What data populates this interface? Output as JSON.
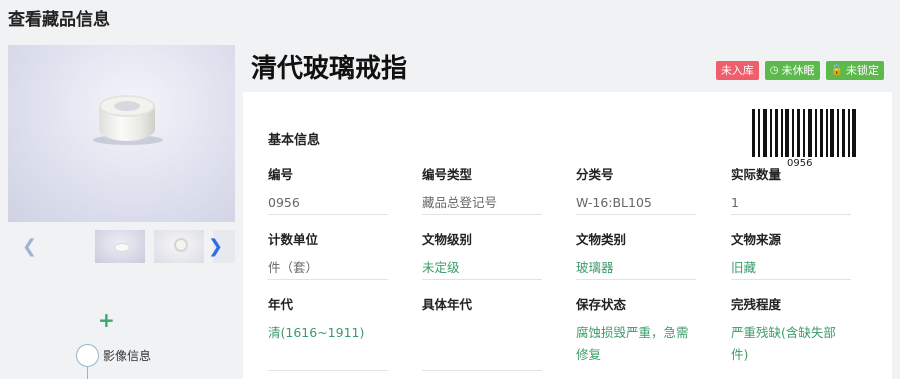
{
  "page": {
    "title": "查看藏品信息"
  },
  "item": {
    "name": "清代玻璃戒指",
    "badges": [
      {
        "label": "未入库",
        "color": "#ef5e6b",
        "icon": ""
      },
      {
        "label": "未休眠",
        "color": "#5cba4c",
        "icon": "clock-icon"
      },
      {
        "label": "未锁定",
        "color": "#5cba4c",
        "icon": "lock-icon"
      }
    ]
  },
  "gallery": {
    "prev_icon": "chevron-left-icon",
    "next_icon": "chevron-right-icon"
  },
  "sidebar": {
    "add_icon": "plus-icon",
    "timeline_label": "影像信息"
  },
  "basic": {
    "section_title": "基本信息",
    "barcode_text": "0956",
    "fields": [
      {
        "label": "编号",
        "value": "0956"
      },
      {
        "label": "编号类型",
        "value": "藏品总登记号"
      },
      {
        "label": "分类号",
        "value": "W-16:BL105"
      },
      {
        "label": "实际数量",
        "value": "1"
      },
      {
        "label": "计数单位",
        "value": "件（套）"
      },
      {
        "label": "文物级别",
        "value": "未定级"
      },
      {
        "label": "文物类别",
        "value": "玻璃器"
      },
      {
        "label": "文物来源",
        "value": "旧藏"
      },
      {
        "label": "年代",
        "value": "清(1616~1911)"
      },
      {
        "label": "具体年代",
        "value": ""
      },
      {
        "label": "保存状态",
        "value": "腐蚀损毁严重，急需修复"
      },
      {
        "label": "完残程度",
        "value": "严重残缺(含缺失部件)"
      }
    ]
  },
  "colors": {
    "accent_green": "#3c9b6a",
    "badge_red": "#ef5e6b",
    "badge_green": "#5cba4c"
  }
}
